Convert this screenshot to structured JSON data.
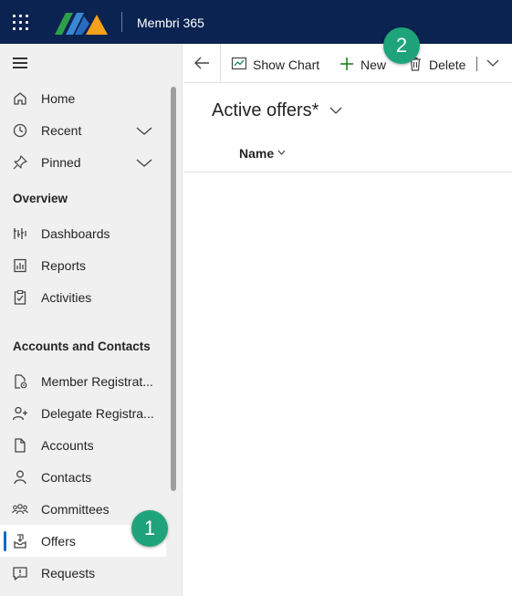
{
  "header": {
    "app_title": "Membri 365"
  },
  "sidebar": {
    "items": [
      {
        "label": "Home",
        "icon": "home-icon"
      },
      {
        "label": "Recent",
        "icon": "clock-icon",
        "expandable": true
      },
      {
        "label": "Pinned",
        "icon": "pin-icon",
        "expandable": true
      }
    ],
    "sections": [
      {
        "title": "Overview",
        "items": [
          {
            "label": "Dashboards",
            "icon": "dashboard-icon"
          },
          {
            "label": "Reports",
            "icon": "report-icon"
          },
          {
            "label": "Activities",
            "icon": "clipboard-icon"
          }
        ]
      },
      {
        "title": "Accounts and Contacts",
        "items": [
          {
            "label": "Member Registrat...",
            "icon": "document-settings-icon"
          },
          {
            "label": "Delegate Registra...",
            "icon": "person-add-icon"
          },
          {
            "label": "Accounts",
            "icon": "document-icon"
          },
          {
            "label": "Contacts",
            "icon": "person-icon"
          },
          {
            "label": "Committees",
            "icon": "people-group-icon"
          },
          {
            "label": "Offers",
            "icon": "inbox-icon",
            "selected": true
          },
          {
            "label": "Requests",
            "icon": "chat-warning-icon"
          }
        ]
      }
    ]
  },
  "command_bar": {
    "show_chart": "Show Chart",
    "new": "New",
    "delete": "Delete"
  },
  "view": {
    "title": "Active offers*",
    "columns": [
      "Name"
    ]
  },
  "callouts": [
    "1",
    "2"
  ],
  "colors": {
    "header_bg": "#0b2350",
    "accent": "#0f6cbd",
    "callout": "#1fa37a",
    "new_icon": "#107c10"
  }
}
